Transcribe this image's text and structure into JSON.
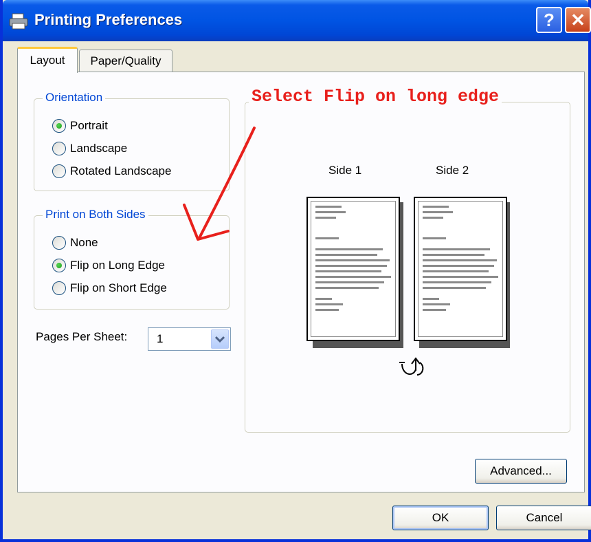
{
  "window": {
    "title": "Printing Preferences",
    "help_glyph": "?",
    "close_glyph": "✕"
  },
  "tabs": [
    {
      "label": "Layout",
      "active": true
    },
    {
      "label": "Paper/Quality",
      "active": false
    }
  ],
  "orientation": {
    "group_label": "Orientation",
    "options": [
      {
        "label": "Portrait",
        "selected": true
      },
      {
        "label": "Landscape",
        "selected": false
      },
      {
        "label": "Rotated Landscape",
        "selected": false
      }
    ]
  },
  "both_sides": {
    "group_label": "Print on Both Sides",
    "options": [
      {
        "label": "None",
        "selected": false
      },
      {
        "label": "Flip on Long Edge",
        "selected": true
      },
      {
        "label": "Flip on Short Edge",
        "selected": false
      }
    ]
  },
  "pages_per_sheet": {
    "label": "Pages Per Sheet:",
    "value": "1"
  },
  "preview": {
    "side1_label": "Side 1",
    "side2_label": "Side 2",
    "flip_glyph": "⟲"
  },
  "annotation": {
    "text": "Select Flip on long edge",
    "color": "#e8201c"
  },
  "buttons": {
    "advanced": "Advanced...",
    "ok": "OK",
    "cancel": "Cancel"
  },
  "colors": {
    "titlebar": "#0054e3",
    "group_label": "#0046d5",
    "tab_highlight": "#ffc83c"
  }
}
